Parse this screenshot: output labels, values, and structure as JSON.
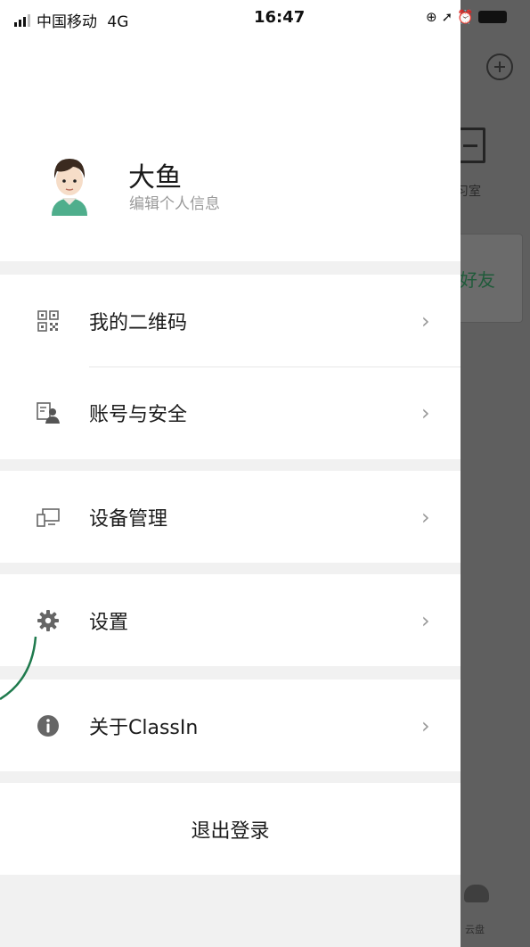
{
  "status_bar": {
    "carrier": "中国移动",
    "network": "4G",
    "time": "16:47",
    "icons": [
      "screen-lock-icon",
      "location-icon",
      "alarm-icon",
      "battery-icon"
    ]
  },
  "profile": {
    "name": "大鱼",
    "edit_label": "编辑个人信息"
  },
  "menu": [
    {
      "label": "我的二维码",
      "icon": "qr-code-icon"
    },
    {
      "label": "账号与安全",
      "icon": "account-card-icon"
    },
    {
      "label": "设备管理",
      "icon": "devices-icon"
    },
    {
      "label": "设置",
      "icon": "gear-icon"
    },
    {
      "label": "关于ClassIn",
      "icon": "info-icon"
    }
  ],
  "logout_label": "退出登录",
  "background_app": {
    "classroom_label": "习室",
    "friend_label": "好友",
    "cloud_label": "云盘"
  },
  "colors": {
    "accent": "#1f7a4d",
    "overlay": "#5f5f5f",
    "separator": "#f1f1f1"
  }
}
